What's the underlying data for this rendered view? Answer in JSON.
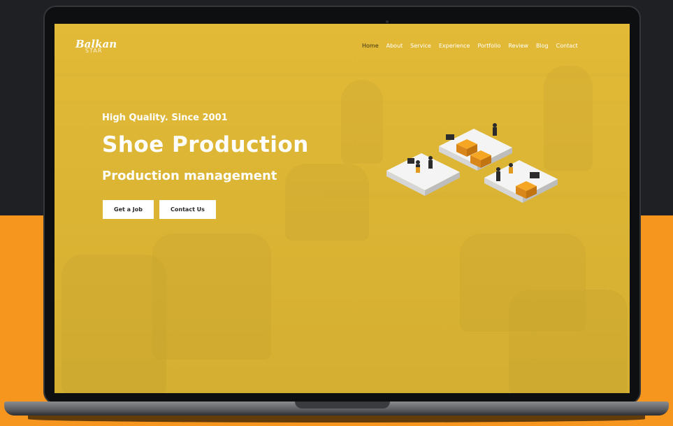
{
  "colors": {
    "background_top": "#1f2024",
    "background_bottom": "#f7961f",
    "screen_tint": "#e0b63a",
    "button_bg": "#ffffff",
    "active_nav": "#3d3211"
  },
  "brand": {
    "name": "Balkan",
    "sub": "STAR"
  },
  "nav": {
    "items": [
      {
        "label": "Home",
        "active": true
      },
      {
        "label": "About"
      },
      {
        "label": "Service"
      },
      {
        "label": "Experience"
      },
      {
        "label": "Portfolio"
      },
      {
        "label": "Review"
      },
      {
        "label": "Blog"
      },
      {
        "label": "Contact"
      }
    ]
  },
  "hero": {
    "eyebrow": "High Quality. Since 2001",
    "title": "Shoe Production",
    "subtitle": "Production management",
    "buttons": {
      "job": "Get a Job",
      "contact": "Contact Us"
    }
  },
  "illustration": {
    "icon": "isometric-office-illustration"
  }
}
